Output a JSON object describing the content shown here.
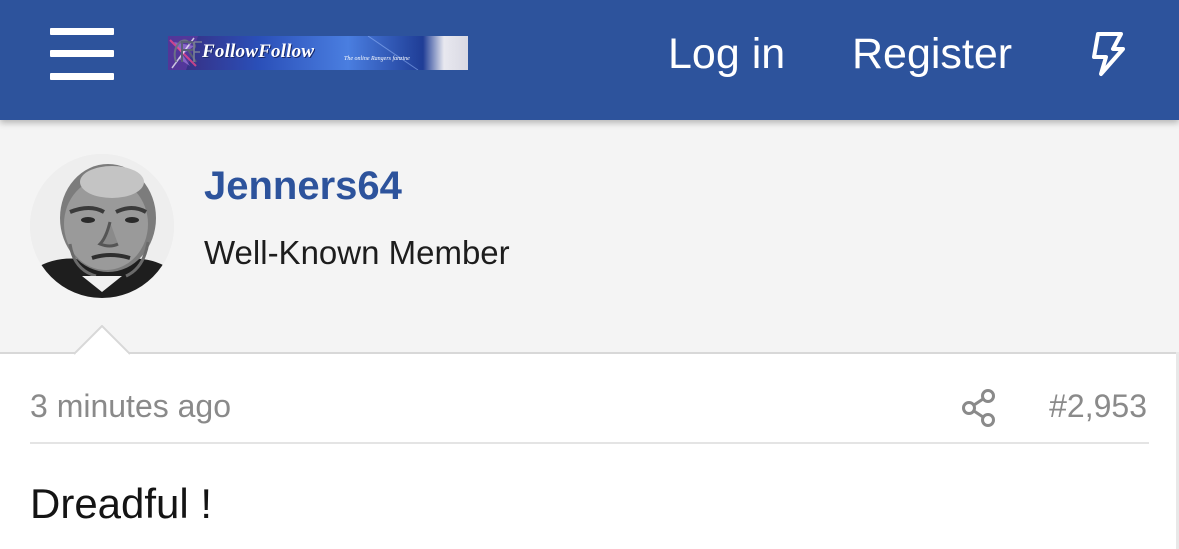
{
  "header": {
    "menu_icon": "hamburger-menu-icon",
    "logo_text": "FollowFollow",
    "logo_tagline": "The online Rangers fanzine",
    "login_label": "Log in",
    "register_label": "Register",
    "whats_new_icon": "lightning-bolt-icon",
    "colors": {
      "bar": "#2d539c",
      "text": "#ffffff"
    }
  },
  "author": {
    "username": "Jenners64",
    "title": "Well-Known Member",
    "avatar_icon": "portrait-photo"
  },
  "post": {
    "timestamp": "3 minutes ago",
    "share_icon": "share-icon",
    "number": "#2,953",
    "body": "Dreadful !"
  }
}
